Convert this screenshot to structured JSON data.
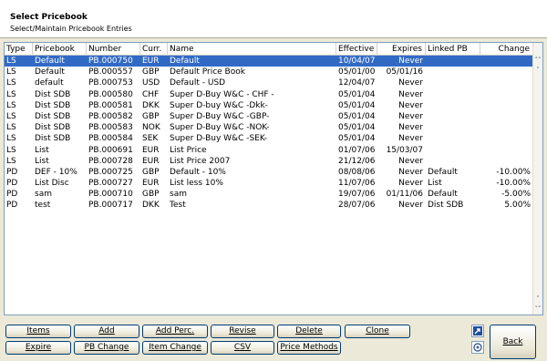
{
  "header": {
    "title": "Select Pricebook",
    "subtitle": "Select/Maintain Pricebook Entries"
  },
  "table": {
    "columns": [
      "Type",
      "Pricebook",
      "Number",
      "Curr.",
      "Name",
      "Effective",
      "Expires",
      "Linked PB",
      "Change"
    ],
    "rows": [
      [
        "LS",
        "Default",
        "PB.000750",
        "EUR",
        "Default",
        "10/04/07",
        "Never",
        "",
        ""
      ],
      [
        "LS",
        "Default",
        "PB.000557",
        "GBP",
        "Default Price Book",
        "05/01/00",
        "05/01/16",
        "",
        ""
      ],
      [
        "LS",
        "default",
        "PB.000753",
        "USD",
        "Default - USD",
        "12/04/07",
        "Never",
        "",
        ""
      ],
      [
        "LS",
        "Dist SDB",
        "PB.000580",
        "CHF",
        "Super D-Buy W&C - CHF -",
        "05/01/04",
        "Never",
        "",
        ""
      ],
      [
        "LS",
        "Dist SDB",
        "PB.000581",
        "DKK",
        "Super D-buy W&C -Dkk-",
        "05/01/04",
        "Never",
        "",
        ""
      ],
      [
        "LS",
        "Dist SDB",
        "PB.000582",
        "GBP",
        "Super D-Buy W&C -GBP-",
        "05/01/04",
        "Never",
        "",
        ""
      ],
      [
        "LS",
        "Dist SDB",
        "PB.000583",
        "NOK",
        "Super D-Buy W&C -NOK-",
        "05/01/04",
        "Never",
        "",
        ""
      ],
      [
        "LS",
        "Dist SDB",
        "PB.000584",
        "SEK",
        "Super D-Buy W&C -SEK-",
        "05/01/04",
        "Never",
        "",
        ""
      ],
      [
        "LS",
        "List",
        "PB.000691",
        "EUR",
        "List Price",
        "01/07/06",
        "15/03/07",
        "",
        ""
      ],
      [
        "LS",
        "List",
        "PB.000728",
        "EUR",
        "List Price  2007",
        "21/12/06",
        "Never",
        "",
        ""
      ],
      [
        "PD",
        "DEF - 10%",
        "PB.000725",
        "GBP",
        "Default - 10%",
        "08/08/06",
        "Never",
        "Default",
        "-10.00%"
      ],
      [
        "PD",
        "List Disc",
        "PB.000727",
        "EUR",
        "List less 10%",
        "11/07/06",
        "Never",
        "List",
        "-10.00%"
      ],
      [
        "PD",
        "sam",
        "PB.000710",
        "GBP",
        "sam",
        "19/07/06",
        "01/11/06",
        "Default",
        "-5.00%"
      ],
      [
        "PD",
        "test",
        "PB.000717",
        "DKK",
        "Test",
        "28/07/06",
        "Never",
        "Dist SDB",
        "5.00%"
      ]
    ],
    "selected_row": 0
  },
  "buttons": {
    "items": "Items",
    "add": "Add",
    "add_perc": "Add Perc.",
    "revise": "Revise",
    "delete": "Delete",
    "clone": "Clone",
    "expire": "Expire",
    "pb_change": "PB Change",
    "item_change": "Item Change",
    "csv": "CSV",
    "price_methods": "Price Methods",
    "back": "Back"
  },
  "icons": {
    "scroll_up": "double-chevron-up-icon",
    "scroll_down": "chevron-down-icon",
    "export": "export-arrow-icon",
    "help": "help-icon"
  },
  "colors": {
    "selection": "#316ac5",
    "background": "#ece9d8",
    "button_border": "#003c74"
  }
}
